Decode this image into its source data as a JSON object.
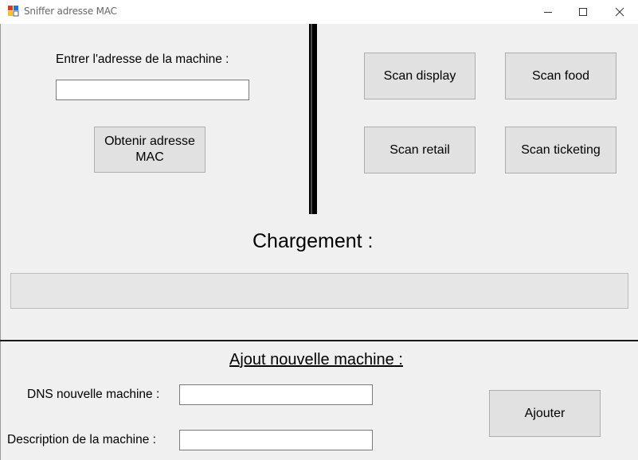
{
  "window": {
    "title": "Sniffer adresse MAC"
  },
  "lookup": {
    "address_label": "Entrer l'adresse de la machine :",
    "address_value": "",
    "get_mac_button": "Obtenir adresse MAC"
  },
  "scans": {
    "display": "Scan display",
    "food": "Scan food",
    "retail": "Scan retail",
    "ticketing": "Scan ticketing"
  },
  "loading": {
    "label": "Chargement :",
    "progress": 0
  },
  "new_machine": {
    "heading": "Ajout nouvelle machine :",
    "dns_label": "DNS nouvelle machine :",
    "dns_value": "",
    "description_label": "Description de la machine :",
    "description_value": "",
    "add_button": "Ajouter"
  },
  "colors": {
    "window_bg": "#f0f0f0",
    "button_bg": "#e1e1e1",
    "progress_fill": "#06b025"
  }
}
